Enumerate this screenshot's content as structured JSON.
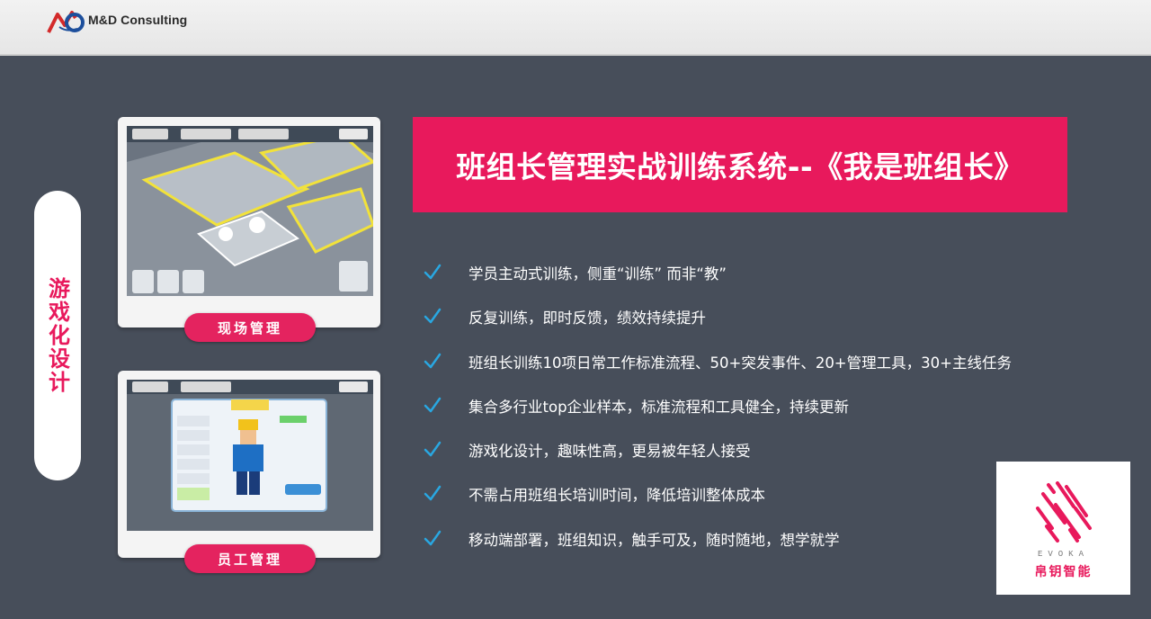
{
  "header": {
    "brand": "M&D Consulting",
    "logo_icon": "md-logo-icon"
  },
  "side_label": "游戏化设计",
  "cards": [
    {
      "caption": "现场管理",
      "screen": "game-site-management-screenshot"
    },
    {
      "caption": "员工管理",
      "screen": "game-employee-management-screenshot"
    }
  ],
  "title": "班组长管理实战训练系统--《我是班组长》",
  "features": [
    "学员主动式训练，侧重“训练” 而非“教”",
    "反复训练，即时反馈，绩效持续提升",
    "班组长训练10项日常工作标准流程、50+突发事件、20+管理工具，30+主线任务",
    "集合多行业top企业样本，标准流程和工具健全，持续更新",
    "游戏化设计，趣味性高，更易被年轻人接受",
    "不需占用班组长培训时间，降低培训整体成本",
    "移动端部署，班组知识，触手可及，随时随地，想学就学"
  ],
  "evoka": {
    "en": "EVOKA",
    "cn": "帛钥智能"
  },
  "colors": {
    "accent": "#e8195c",
    "background": "#474e5a",
    "check": "#29a7e1"
  }
}
